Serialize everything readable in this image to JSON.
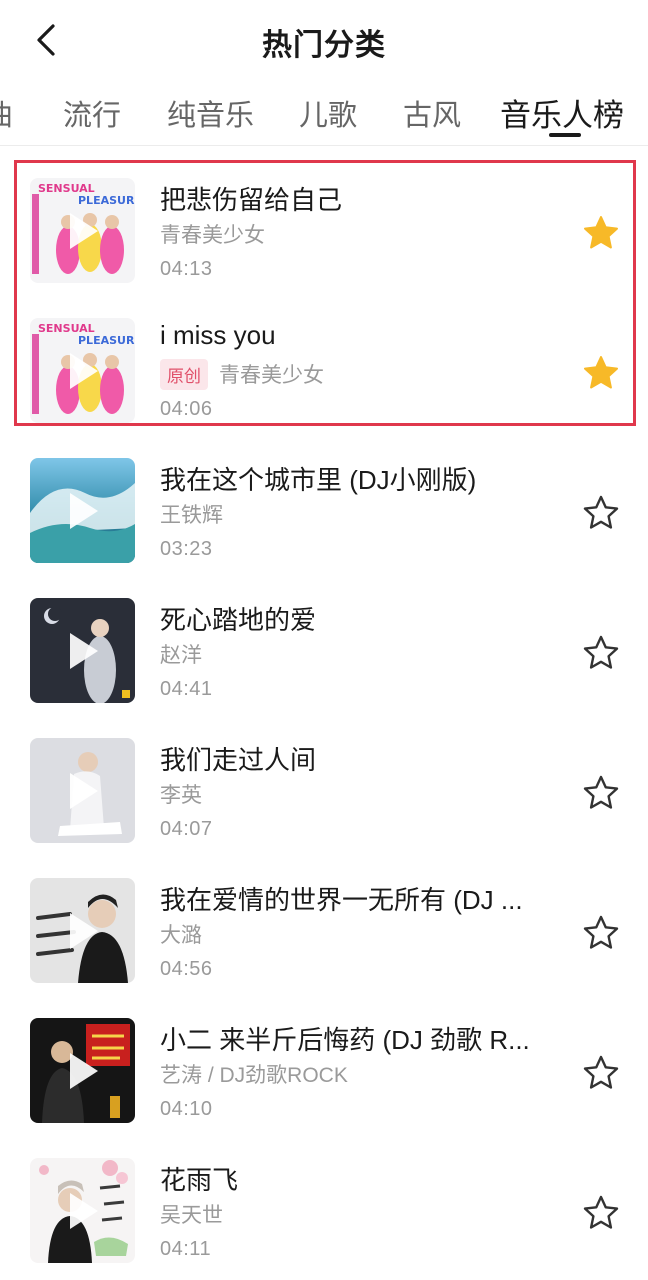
{
  "header": {
    "title": "热门分类",
    "back_icon": "chevron-left-icon"
  },
  "tabs": [
    {
      "label": "曲",
      "active": false
    },
    {
      "label": "流行",
      "active": false
    },
    {
      "label": "纯音乐",
      "active": false
    },
    {
      "label": "儿歌",
      "active": false
    },
    {
      "label": "古风",
      "active": false
    },
    {
      "label": "音乐人榜",
      "active": true
    }
  ],
  "songs": [
    {
      "title": "把悲伤留给自己",
      "badge": "",
      "artist": "青春美少女",
      "duration": "04:13",
      "favorited": true
    },
    {
      "title": "i miss you",
      "badge": "原创",
      "artist": "青春美少女",
      "duration": "04:06",
      "favorited": true
    },
    {
      "title": "我在这个城市里 (DJ小刚版)",
      "badge": "",
      "artist": "王铁辉",
      "duration": "03:23",
      "favorited": false
    },
    {
      "title": "死心踏地的爱",
      "badge": "",
      "artist": "赵洋",
      "duration": "04:41",
      "favorited": false
    },
    {
      "title": "我们走过人间",
      "badge": "",
      "artist": "李英",
      "duration": "04:07",
      "favorited": false
    },
    {
      "title": "我在爱情的世界一无所有 (DJ ...",
      "badge": "",
      "artist": "大潞",
      "duration": "04:56",
      "favorited": false
    },
    {
      "title": "小二 来半斤后悔药 (DJ 劲歌 R...",
      "badge": "",
      "artist": "艺涛 / DJ劲歌ROCK",
      "duration": "04:10",
      "favorited": false
    },
    {
      "title": "花雨飞",
      "badge": "",
      "artist": "吴天世",
      "duration": "04:11",
      "favorited": false
    }
  ],
  "colors": {
    "star_filled": "#f7b928",
    "star_outline": "#333333",
    "badge_text": "#e0506a",
    "badge_bg": "#fbe6ea",
    "highlight_border": "#e0384c"
  }
}
